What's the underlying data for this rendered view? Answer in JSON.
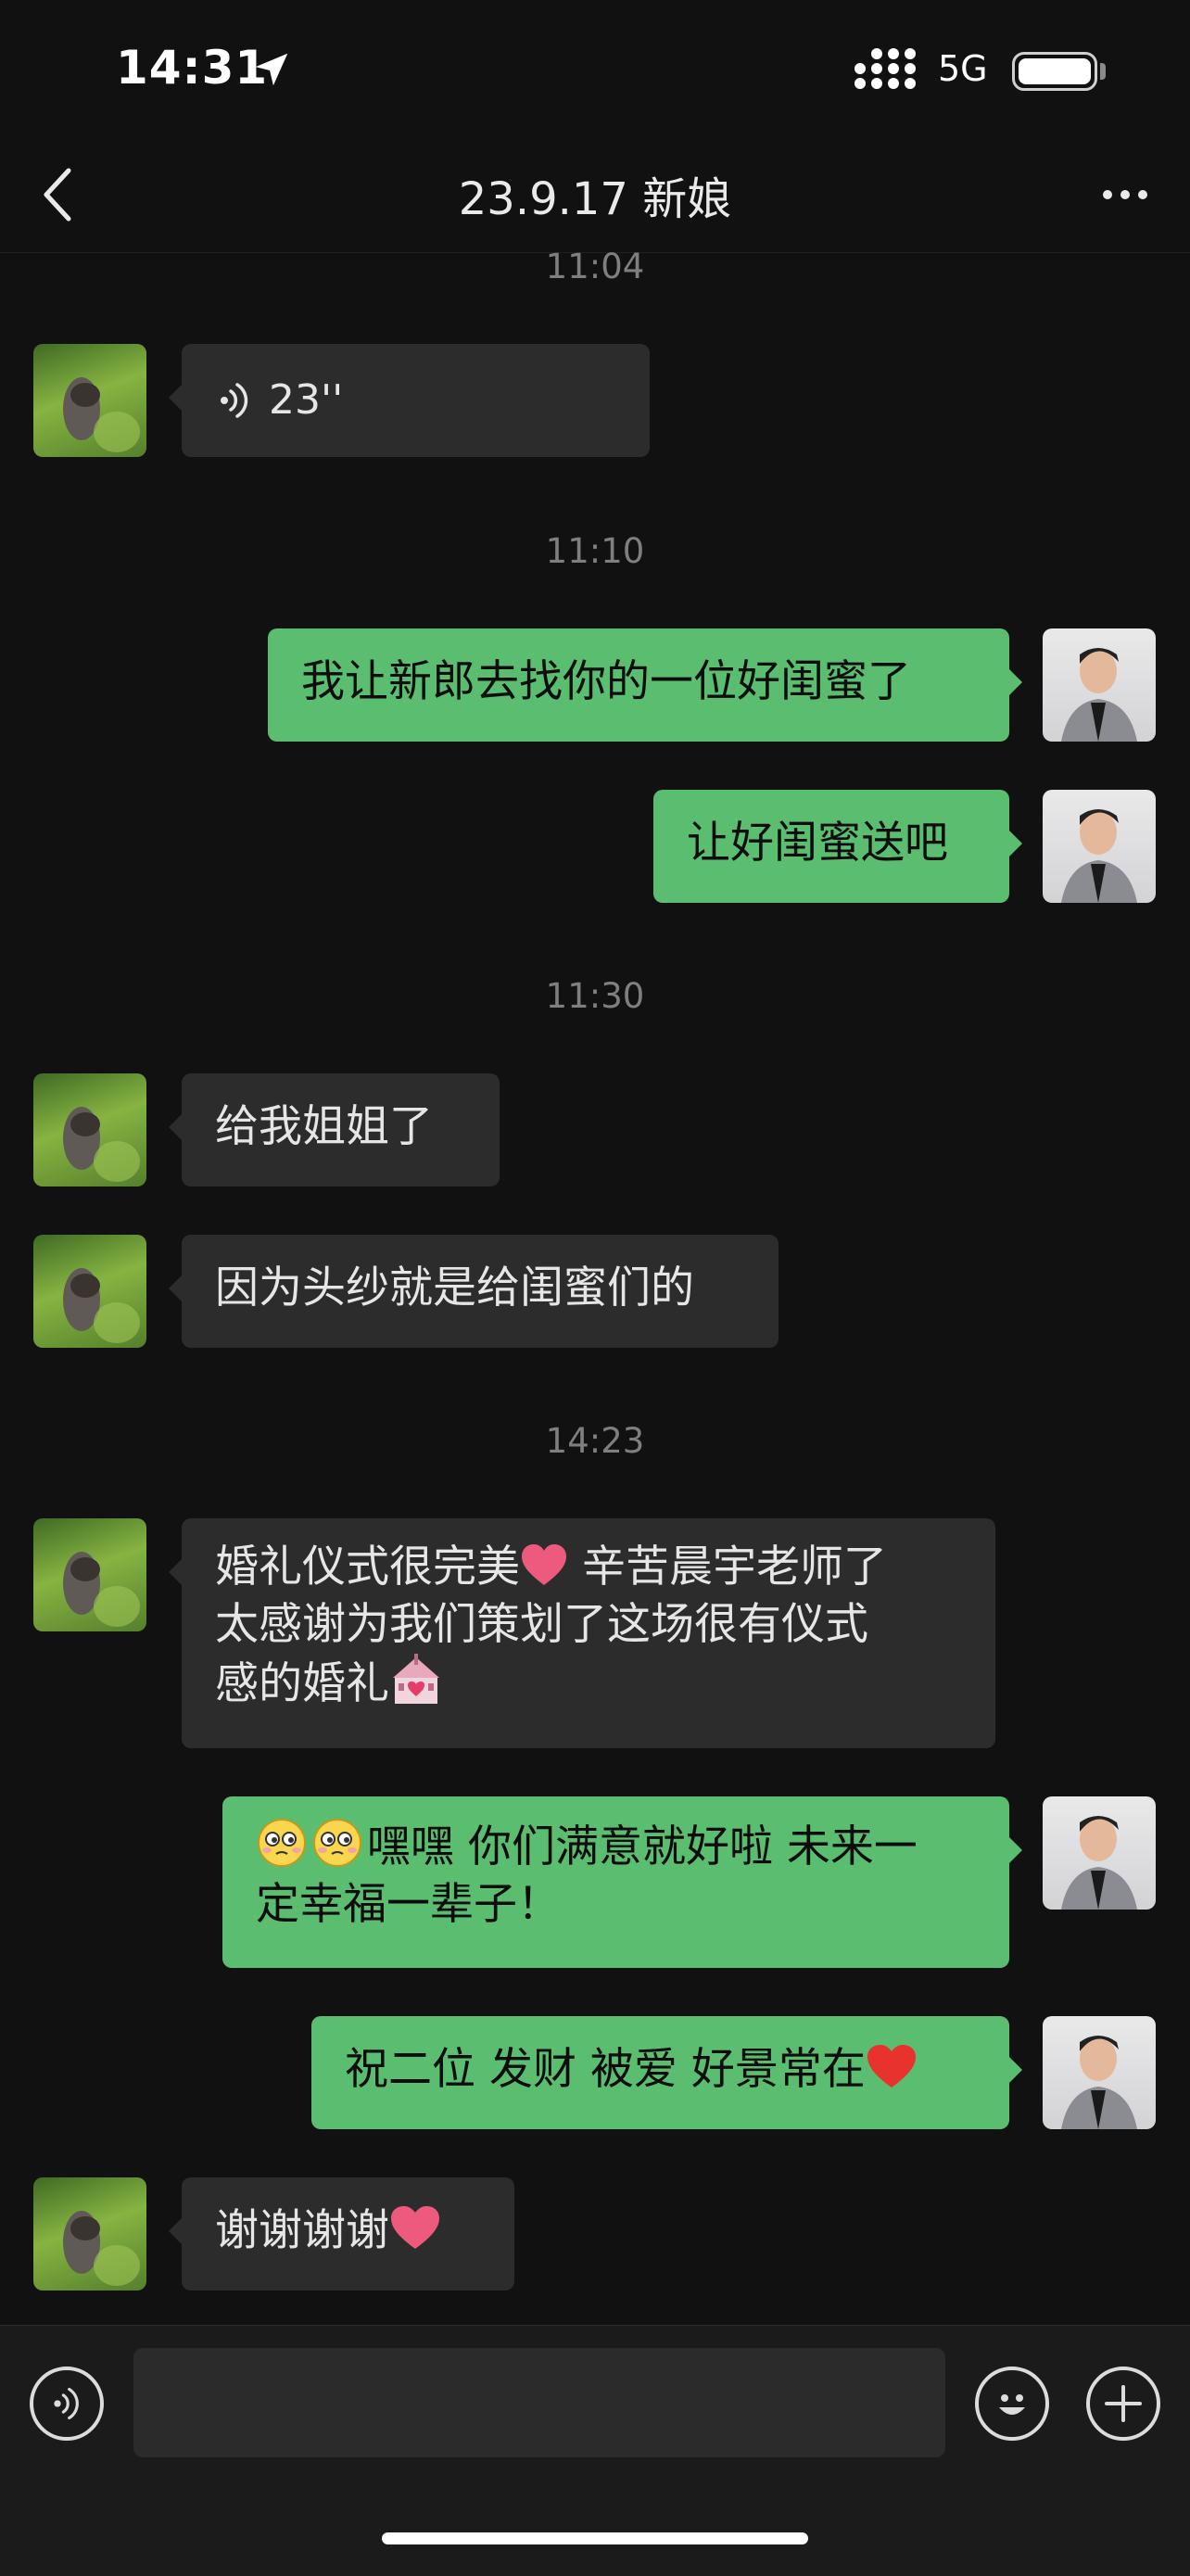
{
  "status_bar": {
    "time": "14:31",
    "network": "5G",
    "icons": [
      "location-arrow-icon",
      "signal-icon",
      "battery-icon"
    ]
  },
  "nav": {
    "title": "23.9.17 新娘",
    "back_icon": "chevron-left-icon",
    "more_icon": "more-dots-icon"
  },
  "messages": [
    {
      "type": "timestamp",
      "text": "11:04"
    },
    {
      "type": "voice",
      "from": "contact",
      "text": "23''"
    },
    {
      "type": "timestamp",
      "text": "11:10"
    },
    {
      "type": "text",
      "from": "me",
      "text": "我让新郎去找你的一位好闺蜜了"
    },
    {
      "type": "text",
      "from": "me",
      "text": "让好闺蜜送吧"
    },
    {
      "type": "timestamp",
      "text": "11:30"
    },
    {
      "type": "text",
      "from": "contact",
      "text": "给我姐姐了"
    },
    {
      "type": "text",
      "from": "contact",
      "text": "因为头纱就是给闺蜜们的"
    },
    {
      "type": "timestamp",
      "text": "14:23"
    },
    {
      "type": "text",
      "from": "contact",
      "lines": [
        "婚礼仪式很完美",
        " 辛苦晨宇老师了",
        "太感谢为我们策划了这场很有仪式",
        "感的婚礼"
      ],
      "emojis": [
        "heart-emoji",
        "chapel-emoji"
      ]
    },
    {
      "type": "text",
      "from": "me",
      "lines": [
        "嘿嘿 你们满意就好啦 未来一",
        "定幸福一辈子！"
      ],
      "emojis": [
        "shy-face-emoji",
        "shy-face-emoji"
      ]
    },
    {
      "type": "text",
      "from": "me",
      "text": "祝二位 发财 被爱 好景常在",
      "emojis": [
        "red-heart-emoji"
      ]
    },
    {
      "type": "text",
      "from": "contact",
      "text": "谢谢谢谢",
      "emojis": [
        "heart-emoji"
      ]
    }
  ],
  "input_bar": {
    "value": "",
    "voice_icon": "voice-mode-icon",
    "emoji_icon": "emoji-icon",
    "add_icon": "plus-circle-icon"
  },
  "colors": {
    "background": "#111111",
    "incoming_bubble": "#2c2c2c",
    "outgoing_bubble": "#5bbd6f",
    "timestamp": "#7f7f7f"
  }
}
